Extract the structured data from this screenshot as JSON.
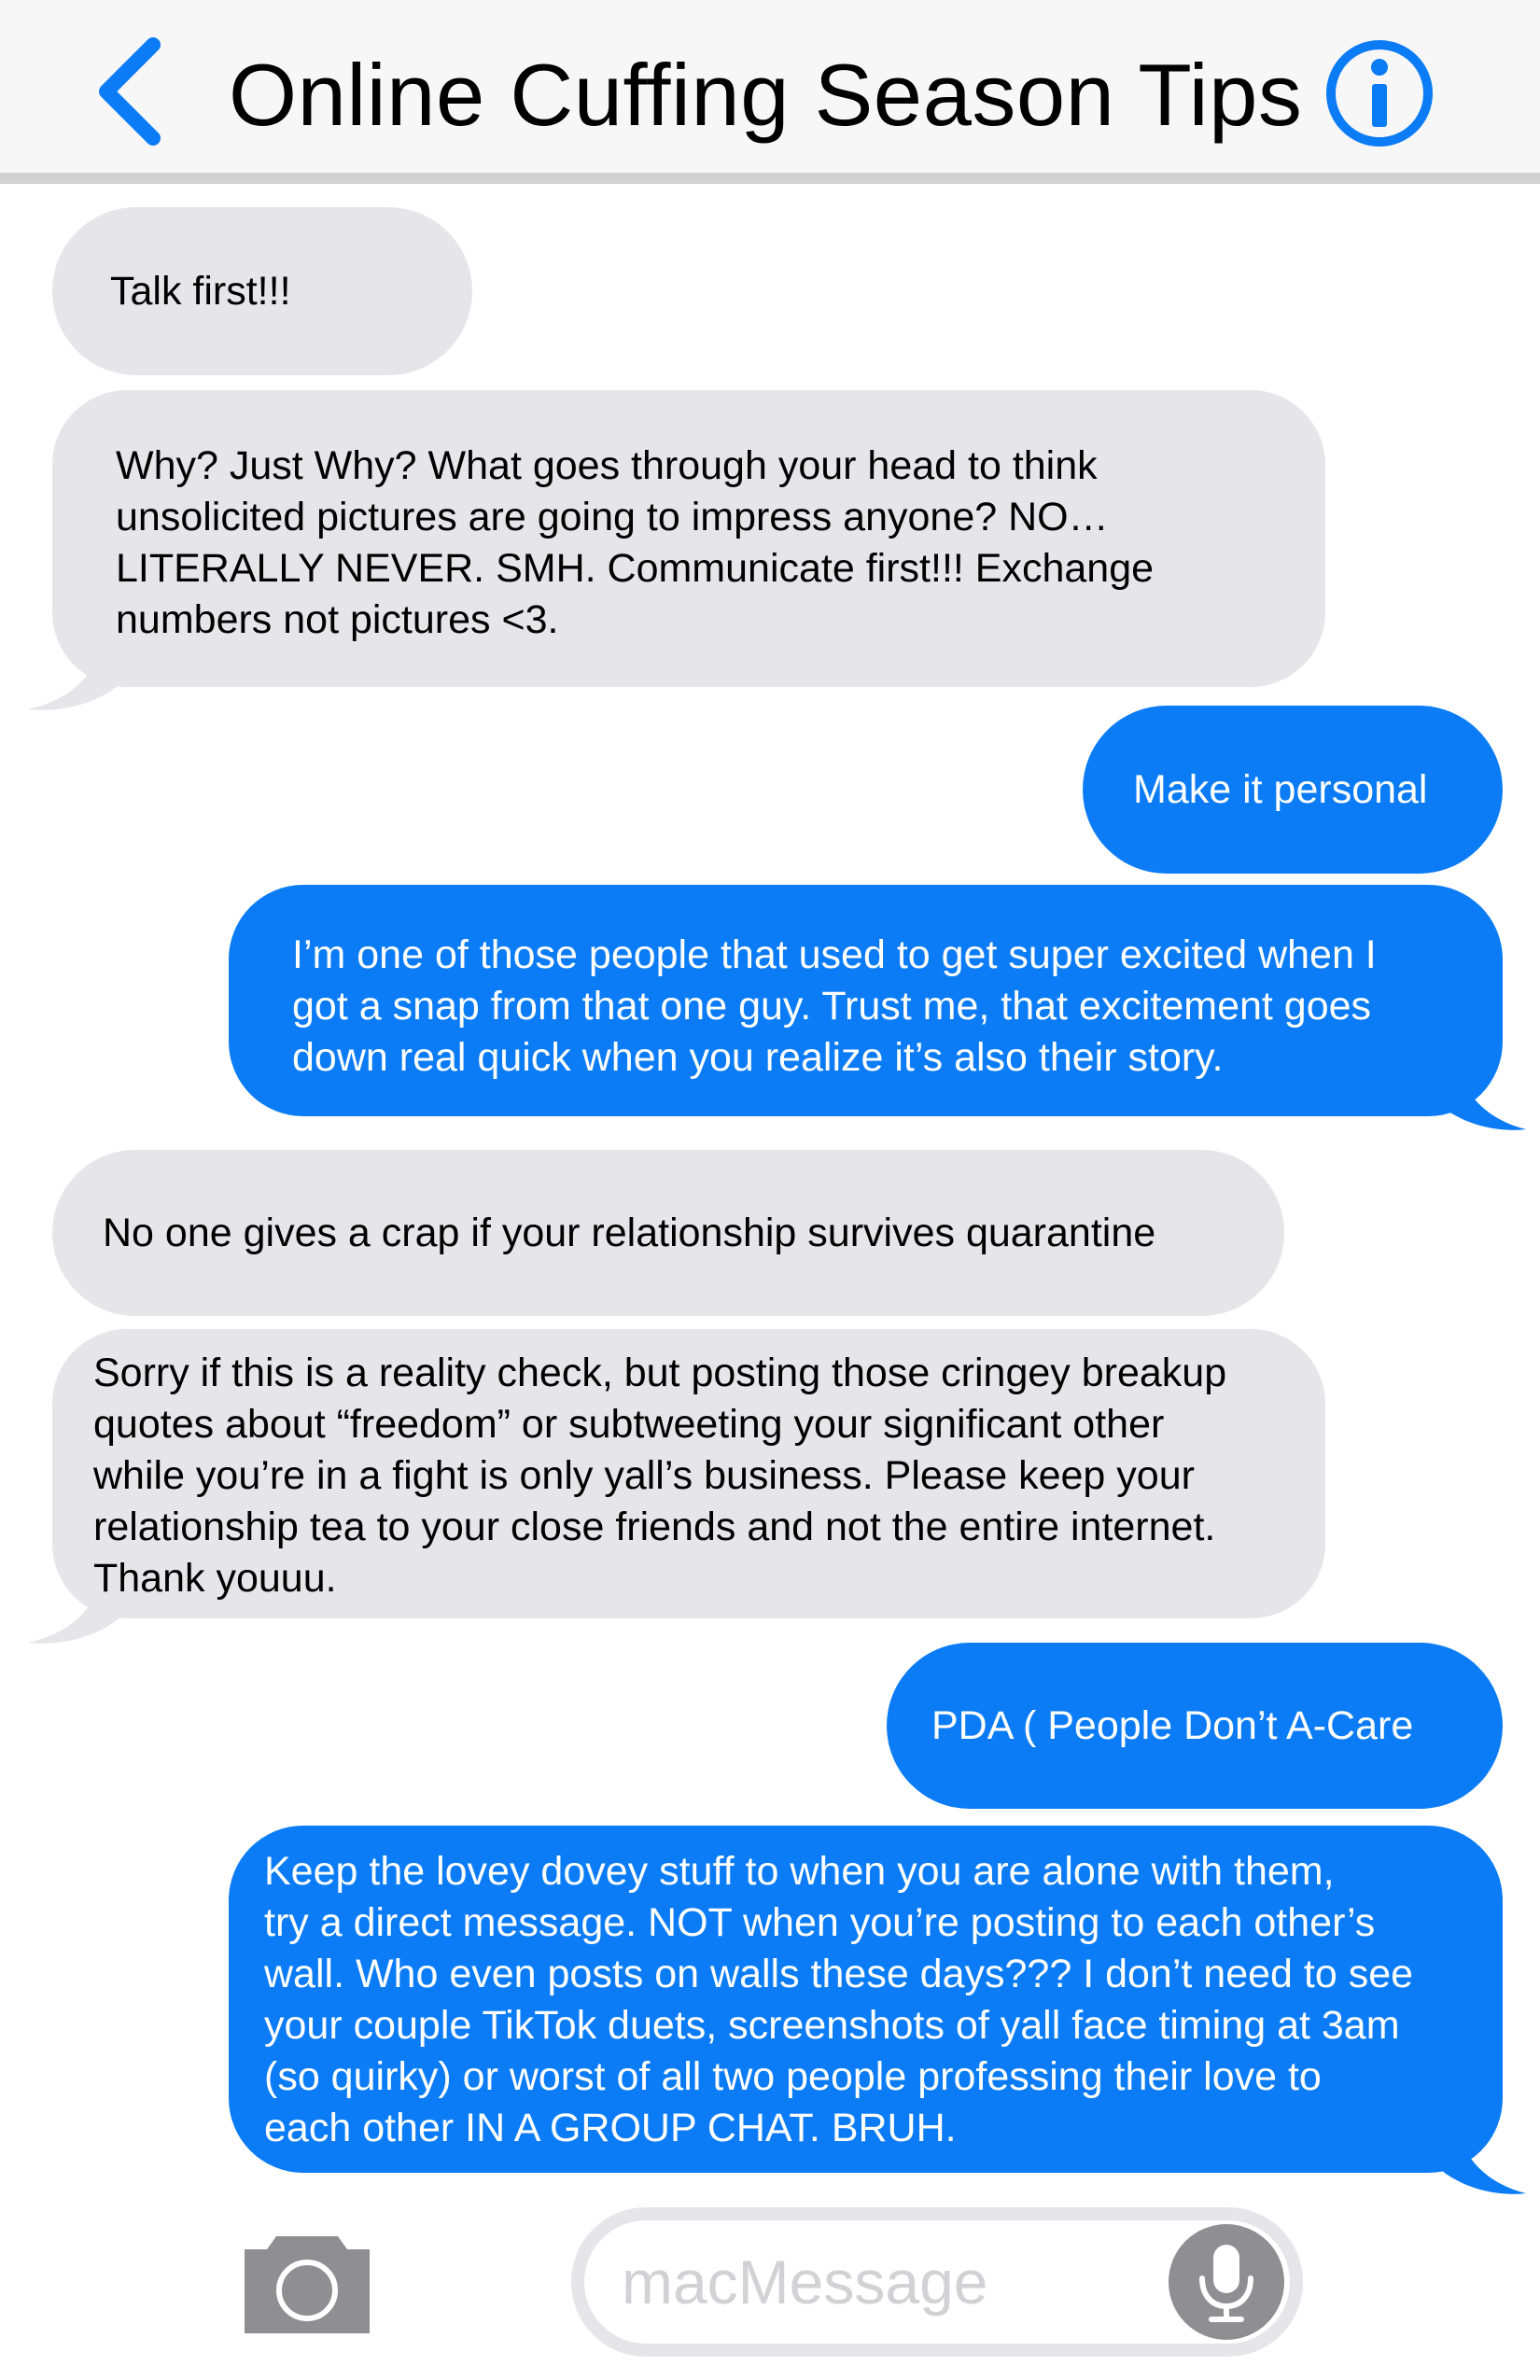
{
  "header": {
    "title": "Online Cuffing Season Tips",
    "back_icon": "chevron-left-icon",
    "info_icon": "info-circle-icon"
  },
  "colors": {
    "accent": "#0b7cf5",
    "received_bubble": "#e5e5ea",
    "header_bg": "#f7f7f7",
    "icon_gray": "#8e8e93"
  },
  "messages": [
    {
      "side": "received",
      "lines": [
        "Talk first!!!"
      ]
    },
    {
      "side": "received",
      "lines": [
        "Why? Just Why? What goes through your head to think",
        "unsolicited pictures are going to impress anyone? NO…",
        "LITERALLY NEVER. SMH. Communicate first!!! Exchange",
        "numbers not pictures <3."
      ]
    },
    {
      "side": "sent",
      "lines": [
        "Make it personal"
      ]
    },
    {
      "side": "sent",
      "lines": [
        "I’m one of those people that used to get super excited when I",
        "got a snap from that one guy. Trust me, that excitement goes",
        "down real quick when you realize it’s also their story."
      ]
    },
    {
      "side": "received",
      "lines": [
        "No one gives a crap if your relationship survives quarantine"
      ]
    },
    {
      "side": "received",
      "lines": [
        "Sorry if this is a reality check, but posting those cringey breakup",
        "quotes about “freedom” or subtweeting your significant other",
        "while you’re in a fight is only yall’s business. Please keep your",
        "relationship tea to your close friends and not the entire internet.",
        "Thank youuu."
      ]
    },
    {
      "side": "sent",
      "lines": [
        "PDA ( People Don’t A-Care"
      ]
    },
    {
      "side": "sent",
      "lines": [
        "Keep the lovey dovey stuff to when you are alone with them,",
        "try a direct message. NOT when you’re posting to each other’s",
        "wall. Who even posts on walls these days??? I don’t need to see",
        "your couple TikTok duets, screenshots of yall face timing at 3am",
        "(so quirky) or worst of all two people professing their love to",
        "each other IN A GROUP CHAT. BRUH."
      ]
    }
  ],
  "footer": {
    "camera_icon": "camera-icon",
    "input_placeholder": "macMessage",
    "mic_icon": "microphone-icon"
  }
}
